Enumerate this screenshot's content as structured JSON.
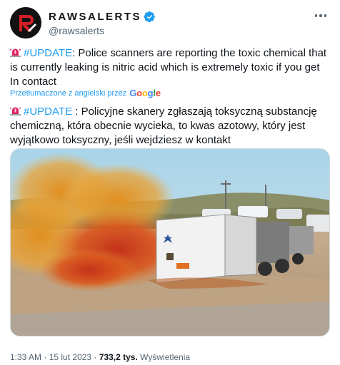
{
  "author": {
    "display_name": "RAWSALERTS",
    "handle": "@rawsalerts",
    "verified": true,
    "avatar_icon": "rawsalerts-logo-icon"
  },
  "tweet": {
    "original": {
      "hashtag": "#UPDATE",
      "text": ": Police scanners are reporting the toxic chemical that is currently leaking is nitric acid which is extremely toxic if you get In contact"
    },
    "translation_note": "Przetłumaczone z angielski przez",
    "translation_provider": "Google",
    "translated": {
      "hashtag": "#UPDATE",
      "text": " : Policyjne skanery zgłaszają toksyczną substancję chemiczną, która obecnie wycieka, to kwas azotowy, który jest wyjątkowo toksyczny, jeśli wejdziesz w kontakt"
    }
  },
  "media": {
    "description_icon": "overturned-truck-chemical-spill-photo"
  },
  "footer": {
    "time": "1:33 AM",
    "separator": " · ",
    "date": "15 lut 2023",
    "views_count": "733,2 tys.",
    "views_label": "Wyświetlenia"
  },
  "colors": {
    "accent": "#1d9bf0",
    "text": "#0f1419",
    "secondary": "#536471",
    "siren": "#e0245e"
  }
}
